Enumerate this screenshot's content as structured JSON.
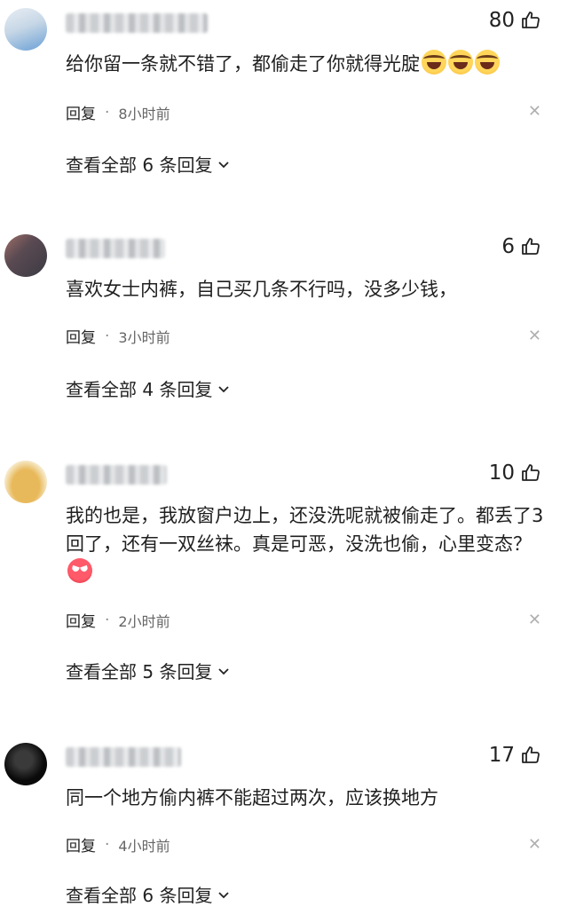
{
  "comments": [
    {
      "username": "blurred-user-1",
      "likes": "80",
      "text": "给你留一条就不错了，都偷走了你就得光腚",
      "emojis": [
        "laugh",
        "laugh",
        "laugh"
      ],
      "reply_label": "回复",
      "separator": "·",
      "time": "8小时前",
      "view_all_label": "查看全部 6 条回复",
      "avatar_colors": [
        "#6aa0d6",
        "#e8eef4"
      ]
    },
    {
      "username": "blurred-user-2",
      "likes": "6",
      "text": "喜欢女士内裤，自己买几条不行吗，没多少钱，",
      "emojis": [],
      "reply_label": "回复",
      "separator": "·",
      "time": "3小时前",
      "view_all_label": "查看全部 4 条回复",
      "avatar_colors": [
        "#3b3a44",
        "#a07068"
      ]
    },
    {
      "username": "blurred-user-3",
      "likes": "10",
      "text": "我的也是，我放窗户边上，还没洗呢就被偷走了。都丢了3回了，还有一双丝袜。真是可恶，没洗也偷，心里变态？",
      "emojis": [
        "angry"
      ],
      "reply_label": "回复",
      "separator": "·",
      "time": "2小时前",
      "view_all_label": "查看全部 5 条回复",
      "avatar_colors": [
        "#e8b95a",
        "#f6e7c4"
      ]
    },
    {
      "username": "blurred-user-4",
      "likes": "17",
      "text": "同一个地方偷内裤不能超过两次，应该换地方",
      "emojis": [],
      "reply_label": "回复",
      "separator": "·",
      "time": "4小时前",
      "view_all_label": "查看全部 6 条回复",
      "avatar_colors": [
        "#0a0a0a",
        "#3a3a3a"
      ]
    }
  ],
  "icons": {
    "like": "thumbs-up-icon",
    "dismiss": "close-icon",
    "expand": "chevron-down-icon"
  }
}
